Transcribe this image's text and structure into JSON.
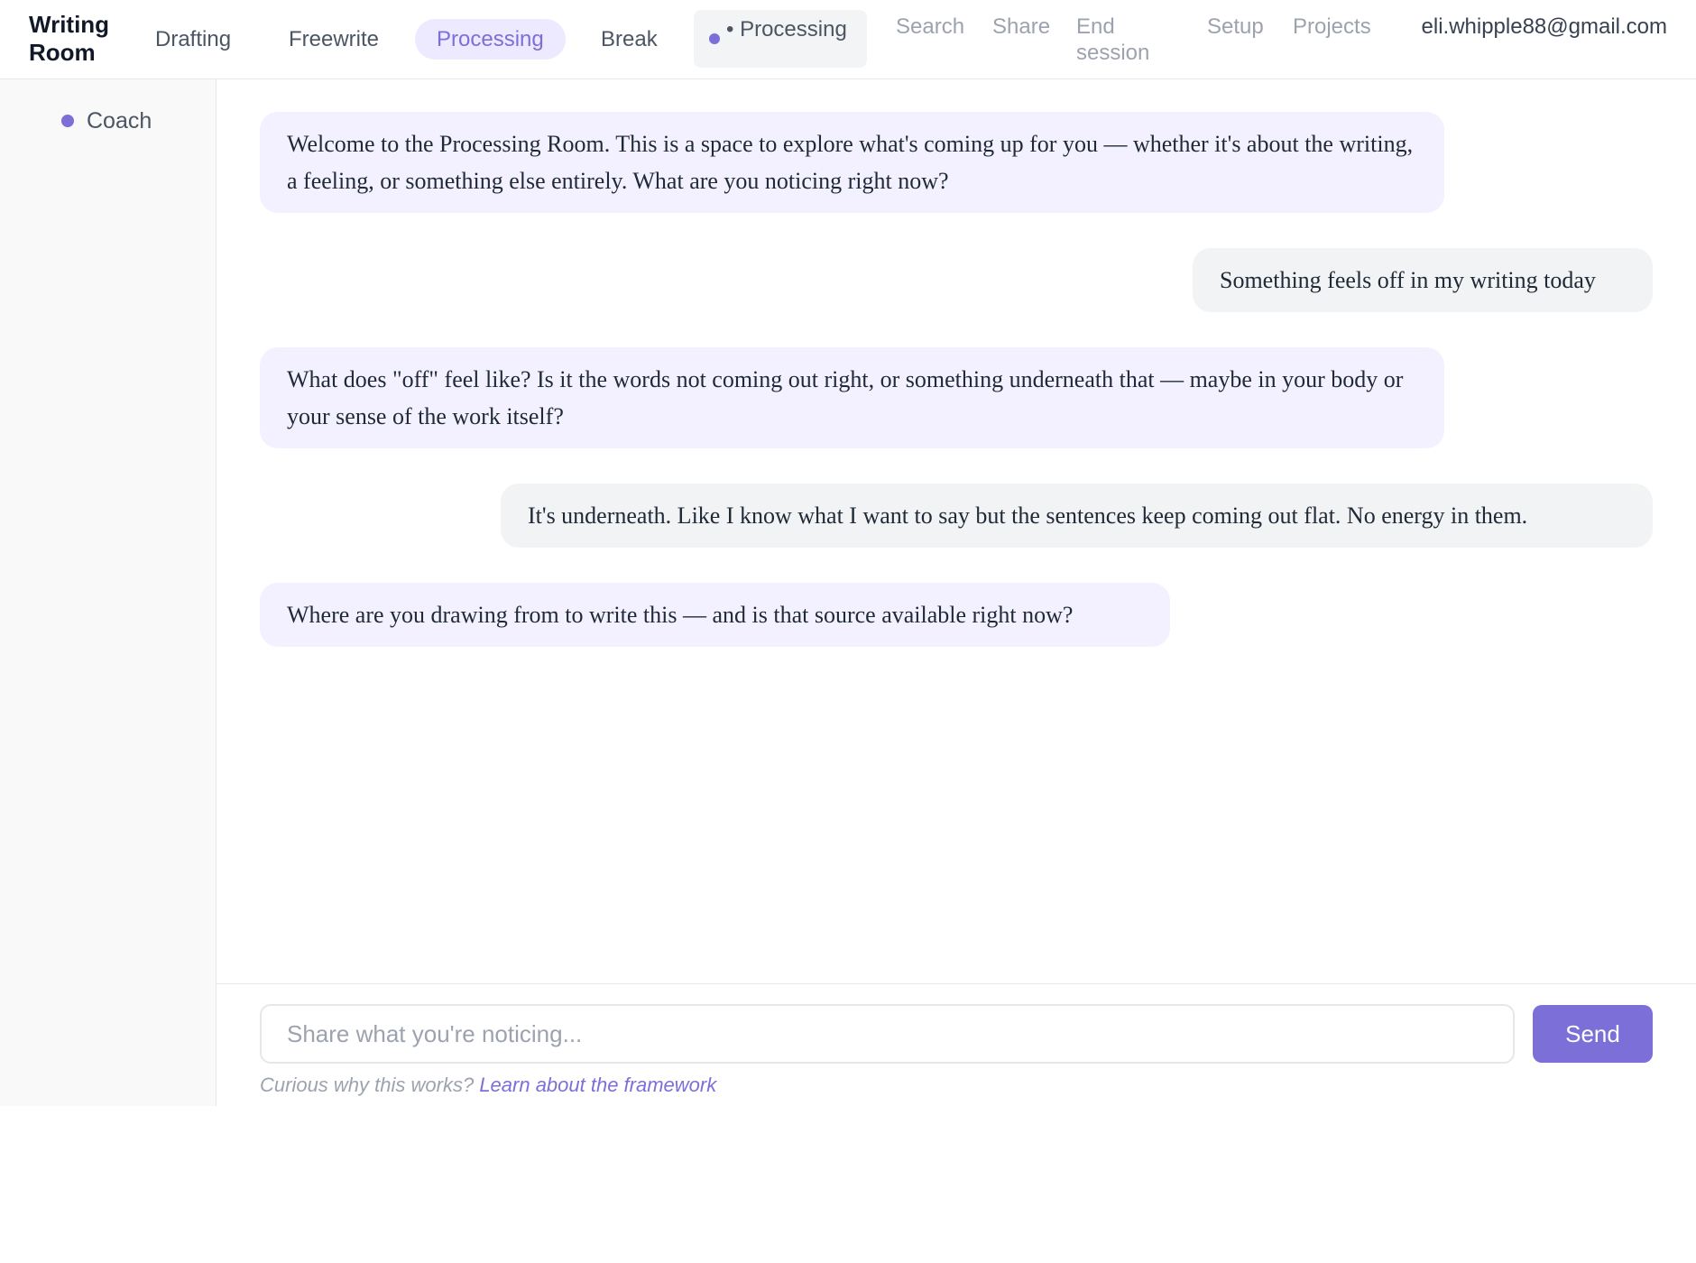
{
  "header": {
    "brand": "Writing Room",
    "tabs": [
      {
        "label": "Drafting",
        "active": false
      },
      {
        "label": "Freewrite",
        "active": false
      },
      {
        "label": "Processing",
        "active": true
      },
      {
        "label": "Break",
        "active": false
      }
    ],
    "mode_indicator": {
      "label": "• Processing",
      "icon": "status-dot-icon"
    },
    "links": {
      "search": "Search",
      "share": "Share",
      "end_session": "End session",
      "setup": "Setup",
      "projects": "Projects"
    },
    "user_email": "eli.whipple88@gmail.com"
  },
  "sidebar": {
    "items": [
      {
        "label": "Coach",
        "icon": "status-dot-icon"
      }
    ]
  },
  "chat": {
    "messages": [
      {
        "role": "coach",
        "text": "Welcome to the Processing Room. This is a space to explore what's coming up for you — whether it's about the writing, a feeling, or something else entirely. What are you noticing right now?"
      },
      {
        "role": "user",
        "text": "Something feels off in my writing today"
      },
      {
        "role": "coach",
        "text": "What does \"off\" feel like? Is it the words not coming out right, or something underneath that — maybe in your body or your sense of the work itself?"
      },
      {
        "role": "user",
        "text": "It's underneath. Like I know what I want to say but the sentences keep coming out flat. No energy in them."
      },
      {
        "role": "coach",
        "text": "Where are you drawing from to write this — and is that source available right now?"
      }
    ]
  },
  "composer": {
    "placeholder": "Share what you're noticing...",
    "value": "",
    "send_label": "Send",
    "note_text": "Curious why this works? ",
    "note_link": "Learn about the framework"
  },
  "colors": {
    "accent": "#7c6fd8",
    "active_tab_bg": "#ede9fe",
    "coach_bubble": "#f3f1ff",
    "user_bubble": "#f2f3f4",
    "sidebar_bg": "#f9f9f9"
  }
}
